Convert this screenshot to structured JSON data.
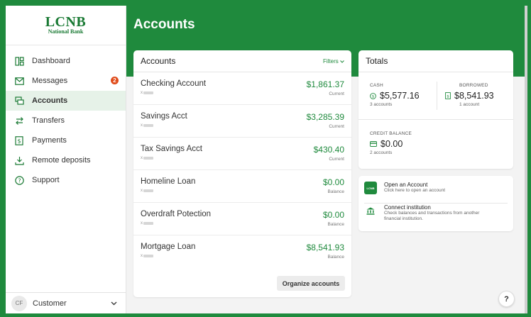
{
  "brand": {
    "logo_main": "LCNB",
    "logo_sub": "National Bank"
  },
  "sidebar": {
    "items": [
      {
        "label": "Dashboard",
        "icon": "dashboard-icon"
      },
      {
        "label": "Messages",
        "icon": "mail-icon",
        "badge": "2"
      },
      {
        "label": "Accounts",
        "icon": "accounts-icon",
        "active": true
      },
      {
        "label": "Transfers",
        "icon": "transfer-icon"
      },
      {
        "label": "Payments",
        "icon": "payment-icon"
      },
      {
        "label": "Remote deposits",
        "icon": "deposit-icon"
      },
      {
        "label": "Support",
        "icon": "help-circle-icon"
      }
    ],
    "user": {
      "initials": "CF",
      "name": "Customer"
    }
  },
  "header": {
    "title": "Accounts"
  },
  "accounts_card": {
    "title": "Accounts",
    "filters_label": "Filters",
    "rows": [
      {
        "name": "Checking Account",
        "mask": "x",
        "amount": "$1,861.37",
        "sub": "Current"
      },
      {
        "name": "Savings Acct",
        "mask": "x",
        "amount": "$3,285.39",
        "sub": "Current"
      },
      {
        "name": "Tax Savings Acct",
        "mask": "x",
        "amount": "$430.40",
        "sub": "Current"
      },
      {
        "name": "Homeline Loan",
        "mask": "x",
        "amount": "$0.00",
        "sub": "Balance"
      },
      {
        "name": "Overdraft Potection",
        "mask": "x",
        "amount": "$0.00",
        "sub": "Balance"
      },
      {
        "name": "Mortgage Loan",
        "mask": "x",
        "amount": "$8,541.93",
        "sub": "Balance"
      }
    ],
    "organize_label": "Organize accounts"
  },
  "totals_card": {
    "title": "Totals",
    "cash": {
      "label": "CASH",
      "value": "$5,577.16",
      "sub": "3 accounts"
    },
    "borrowed": {
      "label": "BORROWED",
      "value": "$8,541.93",
      "sub": "1 account"
    },
    "credit": {
      "label": "CREDIT BALANCE",
      "value": "$0.00",
      "sub": "2 accounts"
    }
  },
  "actions": [
    {
      "title": "Open an Account",
      "desc": "Click here to open an account",
      "icon_text": "LCNB"
    },
    {
      "title": "Connect institution",
      "desc": "Check balances and transactions from another financial institution."
    }
  ],
  "help": {
    "label": "?"
  },
  "colors": {
    "brand_green": "#1f8a3d",
    "badge_red": "#e04b1a"
  }
}
